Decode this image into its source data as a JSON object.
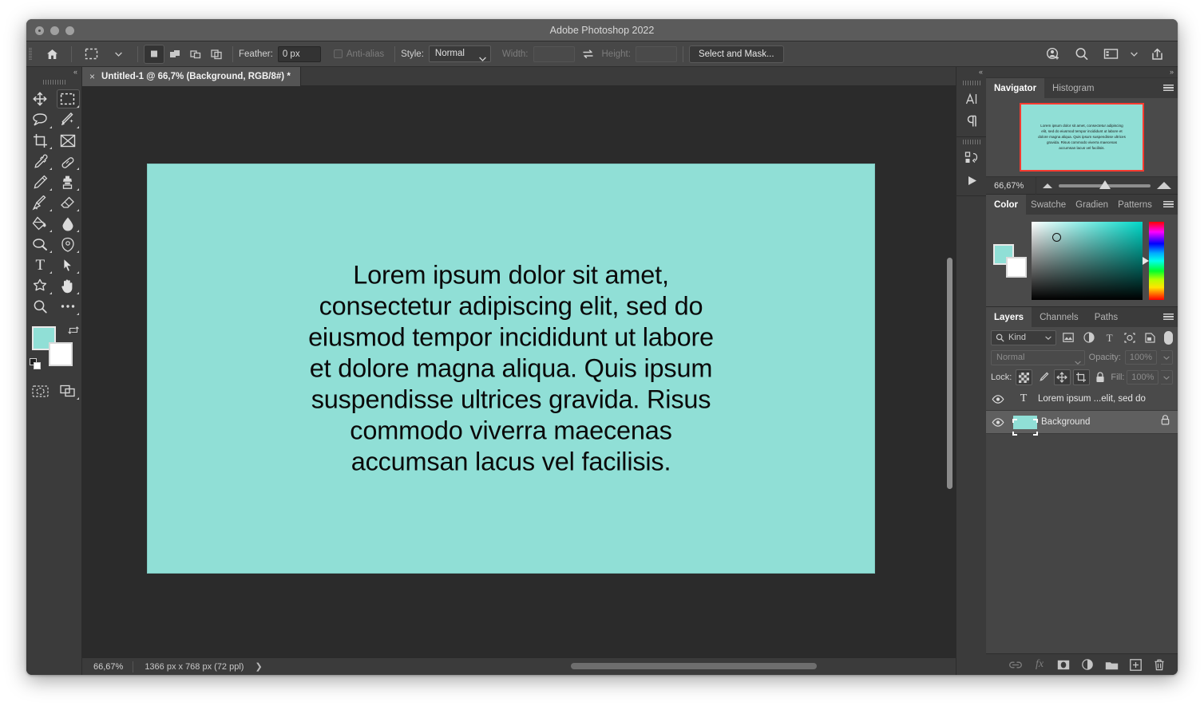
{
  "window": {
    "title": "Adobe Photoshop 2022",
    "traffic_lights": [
      "close",
      "minimize",
      "zoom"
    ]
  },
  "options_bar": {
    "home_icon": "home-icon",
    "tool_preset_icon": "rectangular-marquee-icon",
    "tool_preset_chevron": "chevron-down-icon",
    "selection_modes": [
      "new-selection",
      "add-to-selection",
      "subtract-from-selection",
      "intersect-with-selection"
    ],
    "feather_label": "Feather:",
    "feather_value": "0 px",
    "antialias_label": "Anti-alias",
    "antialias_checked": false,
    "style_label": "Style:",
    "style_value": "Normal",
    "width_label": "Width:",
    "width_value": "",
    "swap_icon": "swap-arrows-icon",
    "height_label": "Height:",
    "height_value": "",
    "select_and_mask_label": "Select and Mask...",
    "right_icons": [
      "add-user-icon",
      "search-icon",
      "workspace-icon",
      "chevron-down-icon",
      "share-icon"
    ]
  },
  "tools": {
    "collapse_icon": "double-chevron-left-icon",
    "items": [
      {
        "name": "move-tool",
        "icon": "move-icon",
        "selected": false,
        "has_flyout": false
      },
      {
        "name": "rectangular-marquee-tool",
        "icon": "marquee-icon",
        "selected": true,
        "has_flyout": true
      },
      {
        "name": "lasso-tool",
        "icon": "lasso-icon",
        "selected": false,
        "has_flyout": true
      },
      {
        "name": "object-selection-tool",
        "icon": "magic-wand-icon",
        "selected": false,
        "has_flyout": true
      },
      {
        "name": "crop-tool",
        "icon": "crop-icon",
        "selected": false,
        "has_flyout": true
      },
      {
        "name": "frame-tool",
        "icon": "frame-icon",
        "selected": false,
        "has_flyout": false
      },
      {
        "name": "eyedropper-tool",
        "icon": "eyedropper-icon",
        "selected": false,
        "has_flyout": true
      },
      {
        "name": "spot-healing-brush-tool",
        "icon": "healing-brush-icon",
        "selected": false,
        "has_flyout": true
      },
      {
        "name": "brush-tool",
        "icon": "pencil-icon",
        "selected": false,
        "has_flyout": true
      },
      {
        "name": "clone-stamp-tool",
        "icon": "stamp-icon",
        "selected": false,
        "has_flyout": true
      },
      {
        "name": "history-brush-tool",
        "icon": "history-brush-icon",
        "selected": false,
        "has_flyout": true
      },
      {
        "name": "eraser-tool",
        "icon": "eraser-icon",
        "selected": false,
        "has_flyout": true
      },
      {
        "name": "gradient-tool",
        "icon": "paint-bucket-icon",
        "selected": false,
        "has_flyout": true
      },
      {
        "name": "blur-tool",
        "icon": "blur-drop-icon",
        "selected": false,
        "has_flyout": true
      },
      {
        "name": "dodge-tool",
        "icon": "dodge-icon",
        "selected": false,
        "has_flyout": true
      },
      {
        "name": "pen-tool",
        "icon": "pen-icon",
        "selected": false,
        "has_flyout": true
      },
      {
        "name": "type-tool",
        "icon": "type-t-icon",
        "selected": false,
        "has_flyout": true
      },
      {
        "name": "path-selection-tool",
        "icon": "arrow-cursor-icon",
        "selected": false,
        "has_flyout": true
      },
      {
        "name": "custom-shape-tool",
        "icon": "star-shape-icon",
        "selected": false,
        "has_flyout": true
      },
      {
        "name": "hand-tool",
        "icon": "hand-icon",
        "selected": false,
        "has_flyout": true
      },
      {
        "name": "zoom-tool",
        "icon": "magnifier-icon",
        "selected": false,
        "has_flyout": false
      },
      {
        "name": "edit-toolbar",
        "icon": "ellipsis-icon",
        "selected": false,
        "has_flyout": true
      }
    ],
    "foreground_color": "#90dfd6",
    "background_color": "#ffffff",
    "swap_colors_icon": "swap-colors-icon",
    "default_colors_icon": "default-colors-icon",
    "quick_mask_icon": "quick-mask-icon",
    "screen_mode_icon": "screen-mode-icon"
  },
  "document": {
    "tab_label": "Untitled-1 @ 66,7% (Background, RGB/8#) *",
    "close_icon": "close-icon",
    "canvas_color": "#90dfd6",
    "canvas_text": "Lorem ipsum dolor sit amet, consectetur adipiscing elit, sed do eiusmod tempor incididunt ut labore et dolore magna aliqua. Quis ipsum suspendisse ultrices gravida. Risus commodo viverra maecenas accumsan lacus vel facilisis."
  },
  "status_bar": {
    "zoom": "66,67%",
    "doc_size": "1366 px x 768 px (72 ppl)",
    "expand_icon": "chevron-right-icon"
  },
  "mini_dock": {
    "collapse_icon": "double-chevron-left-icon",
    "buttons": [
      {
        "name": "character-panel-button",
        "icon": "character-A-icon"
      },
      {
        "name": "paragraph-panel-button",
        "icon": "pilcrow-icon"
      },
      {
        "name": "libraries-panel-button",
        "icon": "libraries-icon"
      },
      {
        "name": "actions-panel-button",
        "icon": "play-triangle-icon"
      }
    ]
  },
  "navigator": {
    "collapse_icon": "double-chevron-right-icon",
    "tabs": [
      {
        "label": "Navigator",
        "active": true
      },
      {
        "label": "Histogram",
        "active": false
      }
    ],
    "menu_icon": "panel-menu-icon",
    "thumb_text": "Lorem ipsum dolor sit amet, consectetur adipiscing elit, sed do eiusmod tempor incididunt ut labore et dolore magna aliqua. Quis ipsum suspendisse ultrices gravida. Risus commodo viverra maecenas accumsan lacus vel facilisis.",
    "view_box_color": "#ff3b30",
    "zoom_value": "66,67%",
    "zoom_out_icon": "small-mountain-icon",
    "zoom_in_icon": "large-mountain-icon"
  },
  "color_panel": {
    "tabs": [
      {
        "label": "Color",
        "active": true
      },
      {
        "label": "Swatche",
        "active": false
      },
      {
        "label": "Gradien",
        "active": false
      },
      {
        "label": "Patterns",
        "active": false
      }
    ],
    "menu_icon": "panel-menu-icon",
    "foreground_color": "#90dfd6",
    "background_color": "#ffffff",
    "picker_hue": "#00d8c8"
  },
  "layers_panel": {
    "tabs": [
      {
        "label": "Layers",
        "active": true
      },
      {
        "label": "Channels",
        "active": false
      },
      {
        "label": "Paths",
        "active": false
      }
    ],
    "menu_icon": "panel-menu-icon",
    "filter_label": "Kind",
    "filter_search_icon": "search-icon",
    "filter_chevron": "chevron-down-icon",
    "filter_icons": [
      "pixel-layer-filter-icon",
      "adjustment-layer-filter-icon",
      "type-layer-filter-icon",
      "shape-layer-filter-icon",
      "smart-object-filter-icon"
    ],
    "filter_toggle": "filter-toggle-switch",
    "blend_mode": "Normal",
    "blend_chevron": "chevron-down-icon",
    "opacity_label": "Opacity:",
    "opacity_value": "100%",
    "lock_label": "Lock:",
    "lock_buttons": [
      {
        "name": "lock-transparent-pixels",
        "icon": "checkerboard-icon",
        "on": true
      },
      {
        "name": "lock-image-pixels",
        "icon": "brush-icon",
        "on": false
      },
      {
        "name": "lock-position",
        "icon": "move-icon",
        "on": true
      },
      {
        "name": "lock-artboard-nesting",
        "icon": "artboard-icon",
        "on": true
      },
      {
        "name": "lock-all",
        "icon": "padlock-icon",
        "on": false
      }
    ],
    "fill_label": "Fill:",
    "fill_value": "100%",
    "layers": [
      {
        "name": "Lorem ipsum ...elit, sed do",
        "type": "text",
        "visible": true,
        "locked": false,
        "selected": false,
        "thumb_glyph": "T"
      },
      {
        "name": "Background",
        "type": "image",
        "visible": true,
        "locked": true,
        "selected": true,
        "thumb_color": "#90dfd6"
      }
    ],
    "footer_buttons": [
      {
        "name": "link-layers-button",
        "icon": "link-icon",
        "enabled": false
      },
      {
        "name": "layer-style-button",
        "icon": "fx-icon",
        "enabled": false
      },
      {
        "name": "add-layer-mask-button",
        "icon": "layer-mask-icon",
        "enabled": true
      },
      {
        "name": "new-adjustment-layer-button",
        "icon": "half-circle-icon",
        "enabled": true
      },
      {
        "name": "new-group-button",
        "icon": "folder-icon",
        "enabled": true
      },
      {
        "name": "new-layer-button",
        "icon": "plus-square-icon",
        "enabled": true
      },
      {
        "name": "delete-layer-button",
        "icon": "trash-icon",
        "enabled": true
      }
    ]
  }
}
